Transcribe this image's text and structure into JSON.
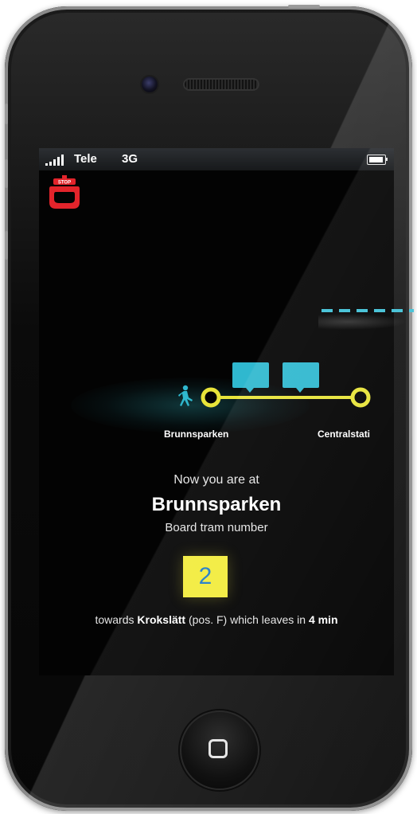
{
  "status_bar": {
    "carrier": "Tele",
    "network": "3G"
  },
  "stop_button": {
    "label": "STOP",
    "color": "#e3242b"
  },
  "route": {
    "current_station": "Brunnsparken",
    "next_station": "Centralstati",
    "line_color": "#e8e43a",
    "bubble_color": "#2fb8cf",
    "walker_color": "#2fb8cf"
  },
  "info": {
    "now_at": "Now you are at",
    "station_name": "Brunnsparken",
    "board_label": "Board tram number",
    "tram_number": "2",
    "towards_prefix": "towards",
    "destination": "Krokslätt",
    "position": "(pos. F)",
    "leaves_text": "which leaves in",
    "minutes": "4 min"
  }
}
